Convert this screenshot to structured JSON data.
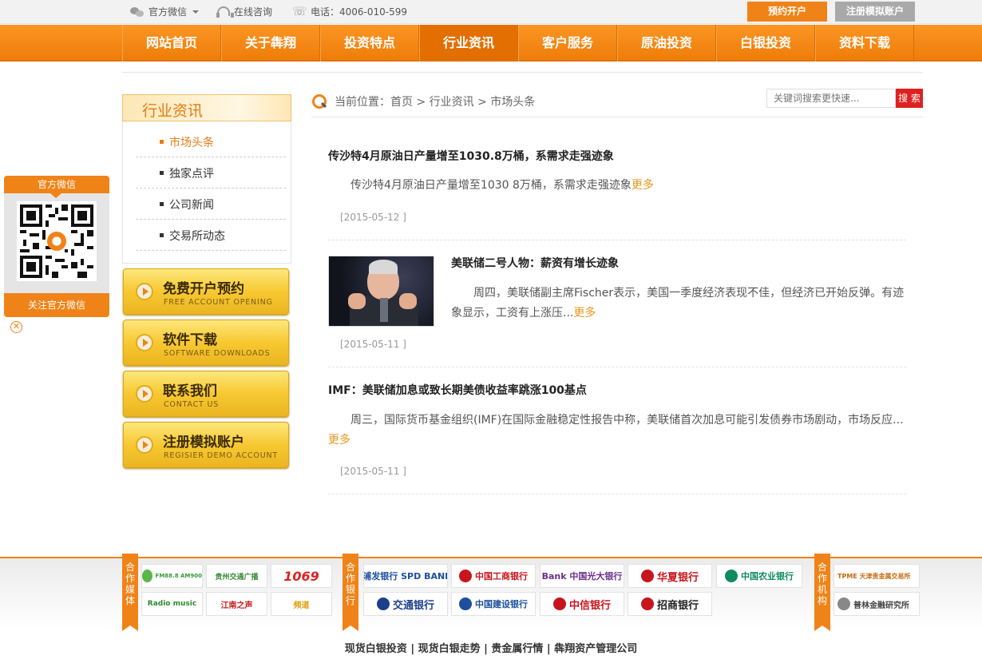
{
  "topbar": {
    "wechat": "官方微信",
    "consult": "在线咨询",
    "phone": "电话：4006-010-599",
    "open_account": "预约开户",
    "register_demo": "注册模拟账户"
  },
  "nav": {
    "items": [
      "网站首页",
      "关于犇翔",
      "投资特点",
      "行业资讯",
      "客户服务",
      "原油投资",
      "白银投资",
      "资料下载"
    ],
    "active_index": 3
  },
  "sidebar": {
    "title": "行业资讯",
    "items": [
      {
        "label": "市场头条",
        "active": true
      },
      {
        "label": "独家点评",
        "active": false
      },
      {
        "label": "公司新闻",
        "active": false
      },
      {
        "label": "交易所动态",
        "active": false
      }
    ],
    "buttons": [
      {
        "cn": "免费开户预约",
        "en": "FREE ACCOUNT OPENING"
      },
      {
        "cn": "软件下载",
        "en": "SOFTWARE DOWNLOADS"
      },
      {
        "cn": "联系我们",
        "en": "CONTACT US"
      },
      {
        "cn": "注册模拟账户",
        "en": "REGISIER DEMO ACCOUNT"
      }
    ]
  },
  "wechat_float": {
    "title": "官方微信",
    "follow": "关注官方微信",
    "close": "✕"
  },
  "breadcrumb": {
    "text": "当前位置：首页 > 行业资讯 > 市场头条"
  },
  "search": {
    "placeholder": "关键词搜索更快速...",
    "button": "搜 索"
  },
  "articles": [
    {
      "title": "传沙特4月原油日产量增至1030.8万桶，系需求走强迹象",
      "summary": "传沙特4月原油日产量增至1030 8万桶，系需求走强迹象",
      "more": "更多",
      "date": "[2015-05-12 ]"
    },
    {
      "title": "美联储二号人物：薪资有增长迹象",
      "summary": "周四，美联储副主席Fischer表示，美国一季度经济表现不佳，但经济已开始反弹。有迹象显示，工资有上涨压...",
      "more": "更多",
      "date": "[2015-05-11 ]"
    },
    {
      "title": "IMF：美联储加息或致长期美债收益率跳涨100基点",
      "summary": "周三，国际货币基金组织(IMF)在国际金融稳定性报告中称，美联储首次加息可能引发债券市场剧动，市场反应...",
      "more": "更多",
      "date": "[2015-05-11 ]"
    }
  ],
  "footer": {
    "media_tag": "合作媒体",
    "bank_tag": "合作银行",
    "org_tag": "合作机构",
    "media": [
      "FM88.8 AM900",
      "贵州交通广播",
      "1069",
      "Radio music",
      "江南之声",
      "频道"
    ],
    "banks": [
      {
        "name": "浦发银行 SPD BANK",
        "color": "#1d4f9c"
      },
      {
        "name": "中国工商银行",
        "color": "#c8151d"
      },
      {
        "name": "Bank 中国光大银行",
        "color": "#6b2f8a"
      },
      {
        "name": "华夏银行",
        "color": "#c8151d"
      },
      {
        "name": "中国农业银行",
        "color": "#0f8a5f"
      },
      {
        "name": "交通银行",
        "color": "#1d3f8a"
      },
      {
        "name": "中国建设银行",
        "color": "#1d4f9c"
      },
      {
        "name": "中信银行",
        "color": "#c8151d"
      },
      {
        "name": "招商银行",
        "color": "#c8151d"
      }
    ],
    "orgs": [
      "TPME 天津贵金属交易所",
      "普林金融研究所"
    ],
    "links": "现货白银投资 | 现货白银走势 | 贵金属行情 | 犇翔资产管理公司"
  }
}
